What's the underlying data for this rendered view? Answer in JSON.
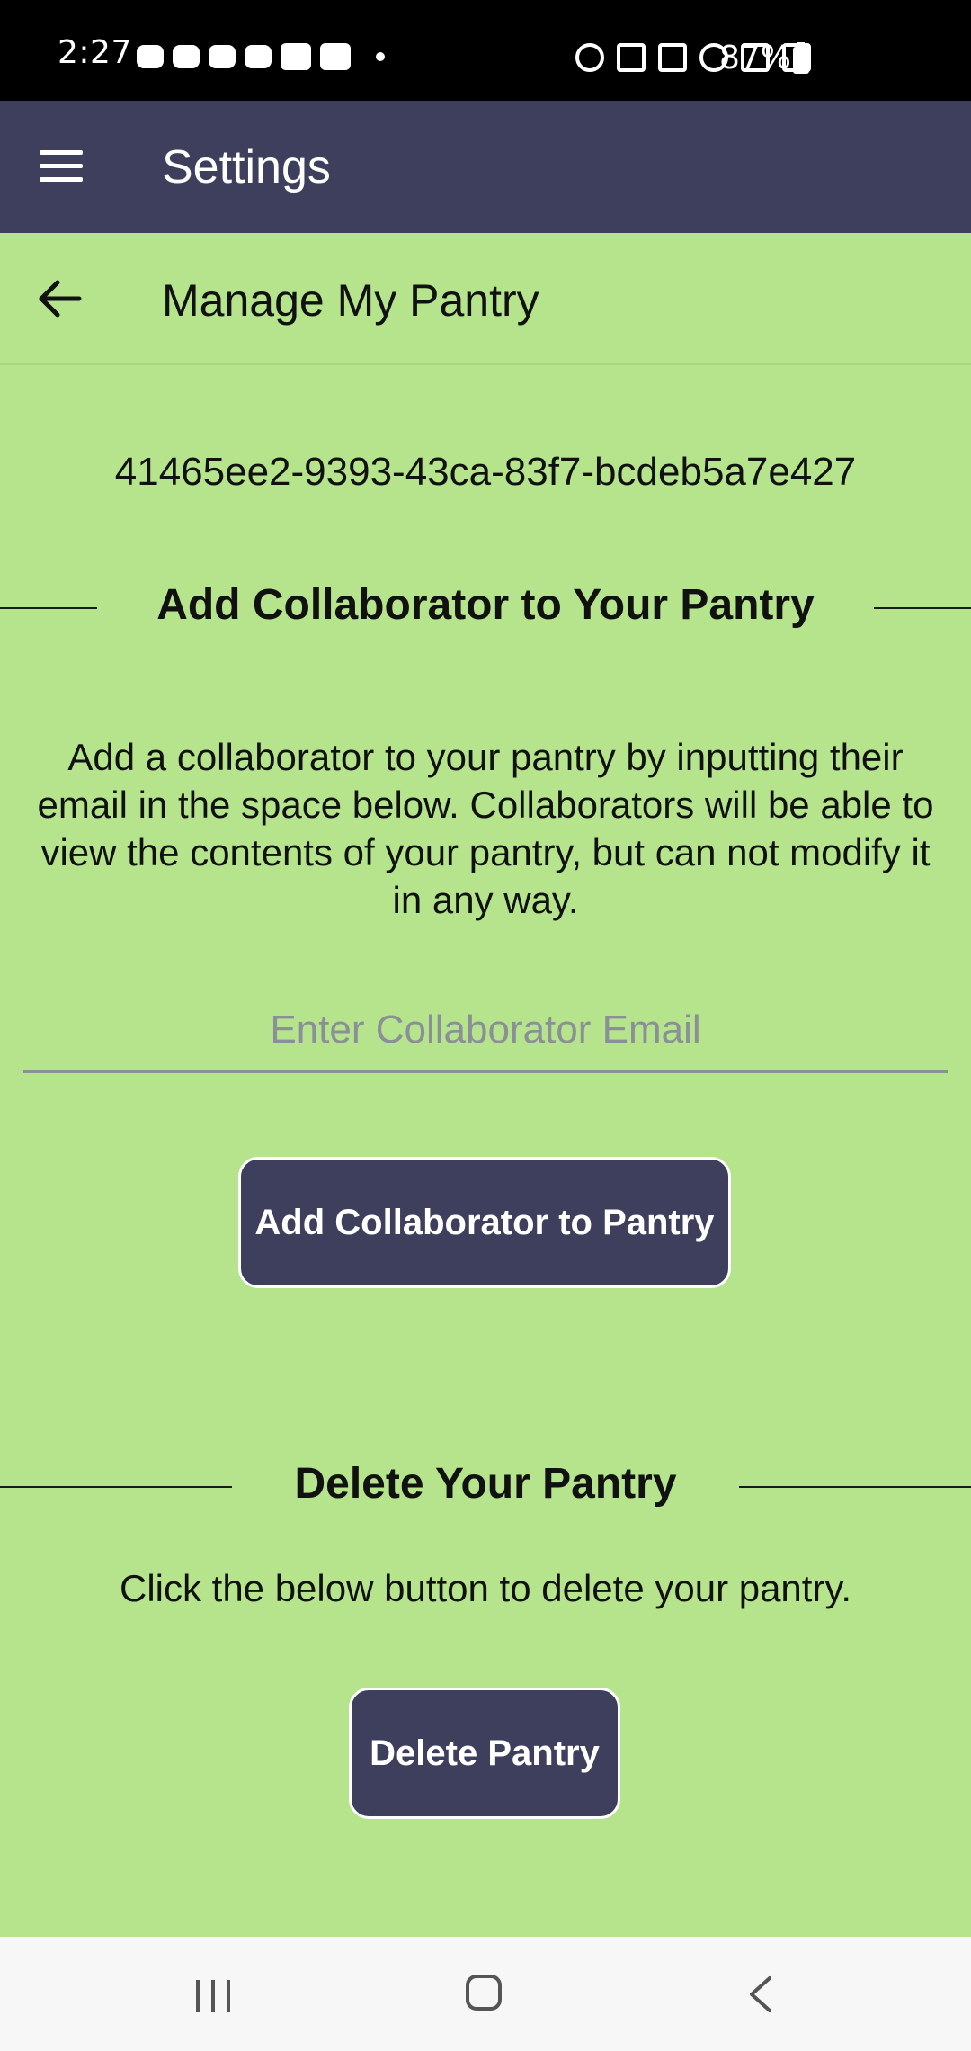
{
  "status_bar": {
    "time": "2:27",
    "battery_percent": "87%",
    "left_icons": [
      "message-icon",
      "game-icon",
      "game-icon",
      "app-icon",
      "youtube-icon",
      "youtube-icon",
      "dot-icon"
    ],
    "right_icons": [
      "alarm-icon",
      "bluetooth-icon",
      "mute-icon",
      "hotspot-icon",
      "lte-icon",
      "signal-icon",
      "battery-icon"
    ]
  },
  "app_bar": {
    "title": "Settings"
  },
  "sub_header": {
    "title": "Manage My Pantry"
  },
  "pantry": {
    "id": "41465ee2-9393-43ca-83f7-bcdeb5a7e427"
  },
  "collaborator_section": {
    "heading": "Add Collaborator to Your Pantry",
    "description": "Add a collaborator to your pantry by inputting their email in the space below. Collaborators will be able to view the contents of your pantry, but can not modify it in any way.",
    "email_placeholder": "Enter Collaborator Email",
    "email_value": "",
    "button_label": "Add Collaborator to Pantry"
  },
  "delete_section": {
    "heading": "Delete Your Pantry",
    "description": "Click the below button to delete your pantry.",
    "button_label": "Delete Pantry"
  },
  "colors": {
    "background": "#b5e48c",
    "app_bar": "#3d3f5c",
    "button": "#3d3f5c"
  }
}
